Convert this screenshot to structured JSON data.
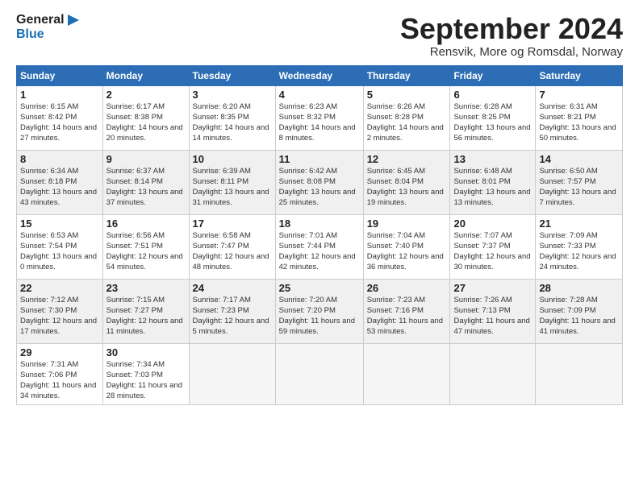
{
  "logo": {
    "line1": "General",
    "line2": "Blue"
  },
  "title": "September 2024",
  "location": "Rensvik, More og Romsdal, Norway",
  "weekdays": [
    "Sunday",
    "Monday",
    "Tuesday",
    "Wednesday",
    "Thursday",
    "Friday",
    "Saturday"
  ],
  "weeks": [
    [
      {
        "day": "1",
        "sunrise": "6:15 AM",
        "sunset": "8:42 PM",
        "daylight": "14 hours and 27 minutes."
      },
      {
        "day": "2",
        "sunrise": "6:17 AM",
        "sunset": "8:38 PM",
        "daylight": "14 hours and 20 minutes."
      },
      {
        "day": "3",
        "sunrise": "6:20 AM",
        "sunset": "8:35 PM",
        "daylight": "14 hours and 14 minutes."
      },
      {
        "day": "4",
        "sunrise": "6:23 AM",
        "sunset": "8:32 PM",
        "daylight": "14 hours and 8 minutes."
      },
      {
        "day": "5",
        "sunrise": "6:26 AM",
        "sunset": "8:28 PM",
        "daylight": "14 hours and 2 minutes."
      },
      {
        "day": "6",
        "sunrise": "6:28 AM",
        "sunset": "8:25 PM",
        "daylight": "13 hours and 56 minutes."
      },
      {
        "day": "7",
        "sunrise": "6:31 AM",
        "sunset": "8:21 PM",
        "daylight": "13 hours and 50 minutes."
      }
    ],
    [
      {
        "day": "8",
        "sunrise": "6:34 AM",
        "sunset": "8:18 PM",
        "daylight": "13 hours and 43 minutes."
      },
      {
        "day": "9",
        "sunrise": "6:37 AM",
        "sunset": "8:14 PM",
        "daylight": "13 hours and 37 minutes."
      },
      {
        "day": "10",
        "sunrise": "6:39 AM",
        "sunset": "8:11 PM",
        "daylight": "13 hours and 31 minutes."
      },
      {
        "day": "11",
        "sunrise": "6:42 AM",
        "sunset": "8:08 PM",
        "daylight": "13 hours and 25 minutes."
      },
      {
        "day": "12",
        "sunrise": "6:45 AM",
        "sunset": "8:04 PM",
        "daylight": "13 hours and 19 minutes."
      },
      {
        "day": "13",
        "sunrise": "6:48 AM",
        "sunset": "8:01 PM",
        "daylight": "13 hours and 13 minutes."
      },
      {
        "day": "14",
        "sunrise": "6:50 AM",
        "sunset": "7:57 PM",
        "daylight": "13 hours and 7 minutes."
      }
    ],
    [
      {
        "day": "15",
        "sunrise": "6:53 AM",
        "sunset": "7:54 PM",
        "daylight": "13 hours and 0 minutes."
      },
      {
        "day": "16",
        "sunrise": "6:56 AM",
        "sunset": "7:51 PM",
        "daylight": "12 hours and 54 minutes."
      },
      {
        "day": "17",
        "sunrise": "6:58 AM",
        "sunset": "7:47 PM",
        "daylight": "12 hours and 48 minutes."
      },
      {
        "day": "18",
        "sunrise": "7:01 AM",
        "sunset": "7:44 PM",
        "daylight": "12 hours and 42 minutes."
      },
      {
        "day": "19",
        "sunrise": "7:04 AM",
        "sunset": "7:40 PM",
        "daylight": "12 hours and 36 minutes."
      },
      {
        "day": "20",
        "sunrise": "7:07 AM",
        "sunset": "7:37 PM",
        "daylight": "12 hours and 30 minutes."
      },
      {
        "day": "21",
        "sunrise": "7:09 AM",
        "sunset": "7:33 PM",
        "daylight": "12 hours and 24 minutes."
      }
    ],
    [
      {
        "day": "22",
        "sunrise": "7:12 AM",
        "sunset": "7:30 PM",
        "daylight": "12 hours and 17 minutes."
      },
      {
        "day": "23",
        "sunrise": "7:15 AM",
        "sunset": "7:27 PM",
        "daylight": "12 hours and 11 minutes."
      },
      {
        "day": "24",
        "sunrise": "7:17 AM",
        "sunset": "7:23 PM",
        "daylight": "12 hours and 5 minutes."
      },
      {
        "day": "25",
        "sunrise": "7:20 AM",
        "sunset": "7:20 PM",
        "daylight": "11 hours and 59 minutes."
      },
      {
        "day": "26",
        "sunrise": "7:23 AM",
        "sunset": "7:16 PM",
        "daylight": "11 hours and 53 minutes."
      },
      {
        "day": "27",
        "sunrise": "7:26 AM",
        "sunset": "7:13 PM",
        "daylight": "11 hours and 47 minutes."
      },
      {
        "day": "28",
        "sunrise": "7:28 AM",
        "sunset": "7:09 PM",
        "daylight": "11 hours and 41 minutes."
      }
    ],
    [
      {
        "day": "29",
        "sunrise": "7:31 AM",
        "sunset": "7:06 PM",
        "daylight": "11 hours and 34 minutes."
      },
      {
        "day": "30",
        "sunrise": "7:34 AM",
        "sunset": "7:03 PM",
        "daylight": "11 hours and 28 minutes."
      },
      null,
      null,
      null,
      null,
      null
    ]
  ]
}
